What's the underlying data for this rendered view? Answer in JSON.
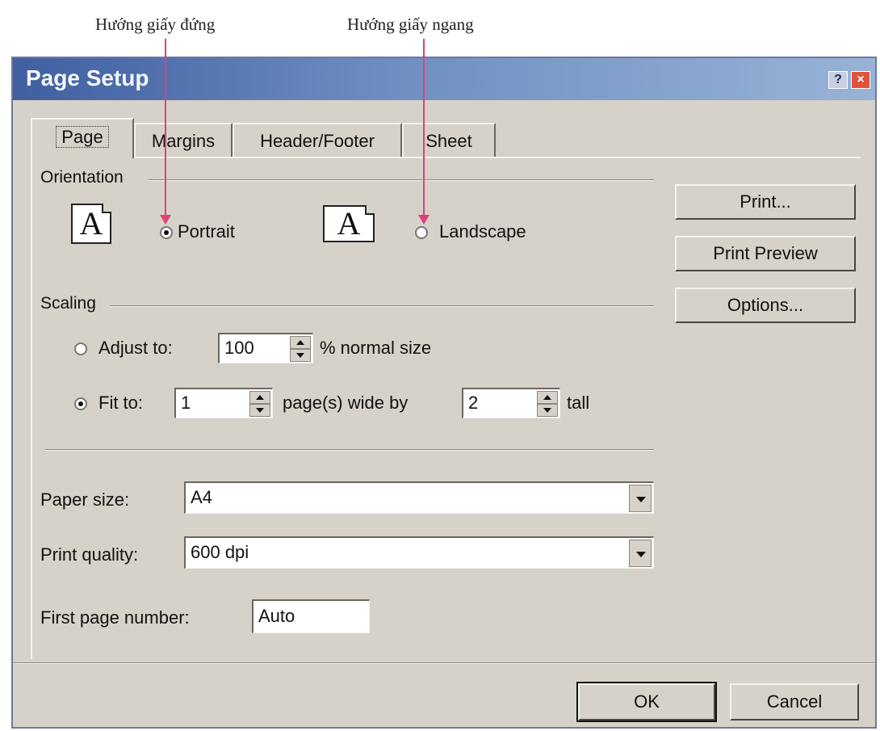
{
  "annotations": {
    "portrait_caption": "Hướng giấy đứng",
    "landscape_caption": "Hướng giấy ngang",
    "arrow_color": "#e0407a"
  },
  "dialog": {
    "title": "Page Setup",
    "help_label": "?",
    "close_label": "×",
    "titlebar_color": "#3f5fa0"
  },
  "tabs": [
    {
      "label": "Page",
      "active": true
    },
    {
      "label": "Margins",
      "active": false
    },
    {
      "label": "Header/Footer",
      "active": false
    },
    {
      "label": "Sheet",
      "active": false
    }
  ],
  "orientation": {
    "group_label": "Orientation",
    "icon_glyph": "A",
    "portrait_label": "Portrait",
    "landscape_label": "Landscape",
    "selected": "portrait"
  },
  "scaling": {
    "group_label": "Scaling",
    "adjust_label": "Adjust to:",
    "adjust_value": "100",
    "adjust_suffix": "% normal size",
    "fit_label": "Fit to:",
    "fit_wide_value": "1",
    "fit_wide_suffix": "page(s) wide by",
    "fit_tall_value": "2",
    "fit_tall_suffix": "tall",
    "selected": "fit"
  },
  "paper": {
    "paper_size_label": "Paper size:",
    "paper_size_value": "A4",
    "print_quality_label": "Print quality:",
    "print_quality_value": "600 dpi",
    "first_page_label": "First page number:",
    "first_page_value": "Auto"
  },
  "side_buttons": {
    "print": "Print...",
    "print_preview": "Print Preview",
    "options": "Options..."
  },
  "footer": {
    "ok": "OK",
    "cancel": "Cancel"
  }
}
